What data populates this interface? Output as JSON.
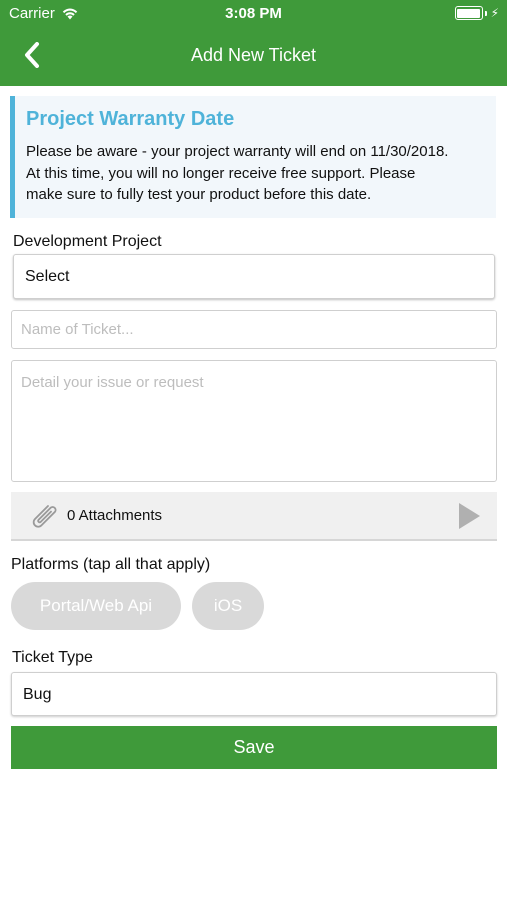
{
  "status_bar": {
    "carrier": "Carrier",
    "time": "3:08 PM"
  },
  "nav": {
    "title": "Add New Ticket"
  },
  "warning": {
    "title": "Project Warranty Date",
    "line1": "Please be aware - your project warranty will end on 11/30/2018.",
    "line2": "At this time, you will no longer receive free support. Please",
    "line3": "make sure to fully test your product before this date."
  },
  "form": {
    "project_label": "Development Project",
    "project_value": "Select",
    "name_placeholder": "Name of Ticket...",
    "detail_placeholder": "Detail your issue or request",
    "attachments_label": "0 Attachments",
    "platforms_label": "Platforms (tap all that apply)",
    "platforms": [
      "Portal/Web Api",
      "iOS"
    ],
    "ticket_type_label": "Ticket Type",
    "ticket_type_value": "Bug",
    "save_label": "Save"
  },
  "colors": {
    "brand_green": "#3f9a3a",
    "warning_accent": "#4fb3d9",
    "chip_gray": "#d9d9d9"
  },
  "icons": [
    "wifi-icon",
    "battery-icon",
    "charging-icon",
    "back-chevron-icon",
    "paperclip-icon",
    "play-arrow-icon"
  ]
}
